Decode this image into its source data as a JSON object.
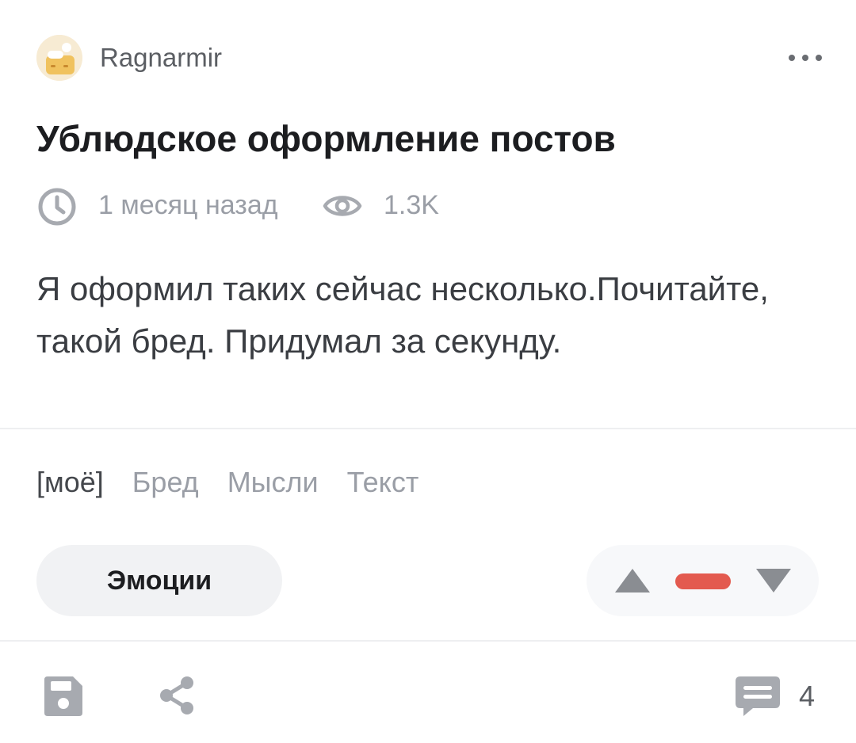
{
  "post": {
    "author": "Ragnarmir",
    "title": "Ублюдское оформление постов",
    "time_ago": "1 месяц назад",
    "views": "1.3K",
    "body": "Я оформил таких сейчас несколько.Почитайте, такой бред. Придумал за секунду."
  },
  "tags": {
    "own": "[моё]",
    "items": [
      "Бред",
      "Мысли",
      "Текст"
    ]
  },
  "actions": {
    "emotions_label": "Эмоции",
    "comments_count": "4"
  },
  "icons": {
    "more": "more-dots-icon",
    "time": "clock-icon",
    "views": "eye-icon",
    "vote_up": "triangle-up-icon",
    "vote_neutral": "minus-bar-icon",
    "vote_down": "triangle-down-icon",
    "save": "floppy-disk-icon",
    "share": "share-icon",
    "comments": "comment-icon"
  },
  "colors": {
    "vote_indicator": "#e35a4f",
    "icon_gray": "#a7aab0",
    "title": "#1c1d20"
  }
}
